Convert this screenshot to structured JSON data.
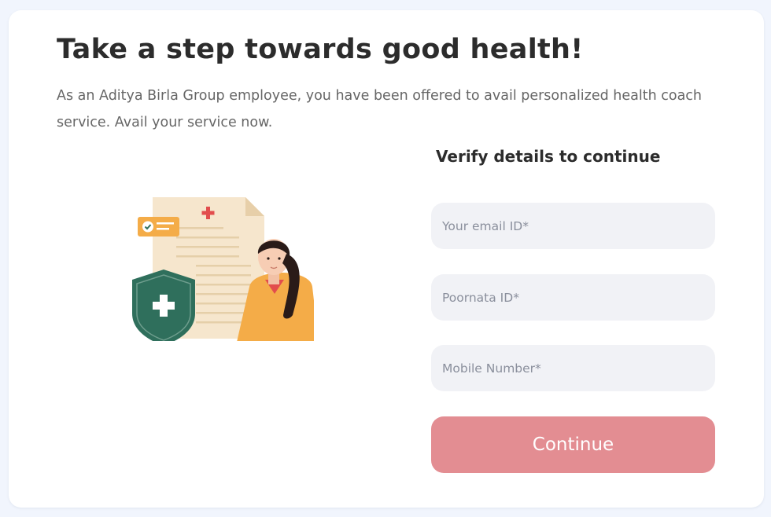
{
  "header": {
    "title": "Take a step towards good health!",
    "subtitle": "As an Aditya Birla Group employee, you have been offered to avail personalized health coach service. Avail your service now."
  },
  "form": {
    "heading": "Verify details to continue",
    "email_placeholder": "Your email ID*",
    "poornata_placeholder": "Poornata ID*",
    "mobile_placeholder": "Mobile Number*",
    "continue_label": "Continue"
  },
  "colors": {
    "page_background": "#f1f5fd",
    "card_background": "#ffffff",
    "input_background": "#f1f2f6",
    "button": "#e38d92",
    "shield": "#2f6f5c",
    "accent_orange": "#f4ac48"
  }
}
